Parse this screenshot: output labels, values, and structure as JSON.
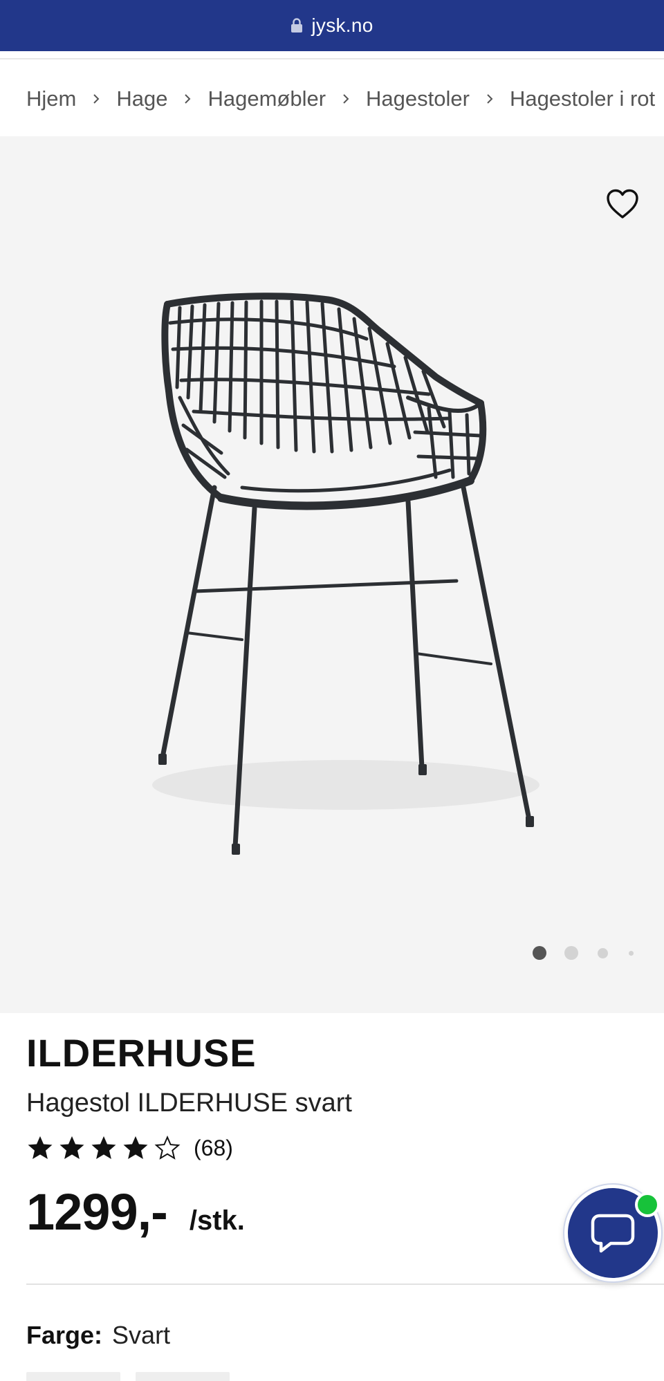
{
  "browser": {
    "url": "jysk.no"
  },
  "breadcrumb": {
    "items": [
      "Hjem",
      "Hage",
      "Hagemøbler",
      "Hagestoler",
      "Hagestoler i rot"
    ]
  },
  "product": {
    "name": "ILDERHUSE",
    "subtitle": "Hagestol ILDERHUSE svart",
    "rating": 4,
    "rating_max": 5,
    "review_count": "(68)",
    "price": "1299,-",
    "price_unit": "/stk.",
    "color_label": "Farge:",
    "color_value": "Svart"
  },
  "gallery": {
    "image_count": 4,
    "active_index": 0
  },
  "colors": {
    "header_bg": "#22378a",
    "chat_bg": "#22378a",
    "online": "#17c23a"
  },
  "icons": {
    "lock": "lock-icon",
    "favorite": "heart-outline-icon",
    "chat": "chat-bubble-icon",
    "breadcrumb_sep": "chevron-right-icon"
  }
}
